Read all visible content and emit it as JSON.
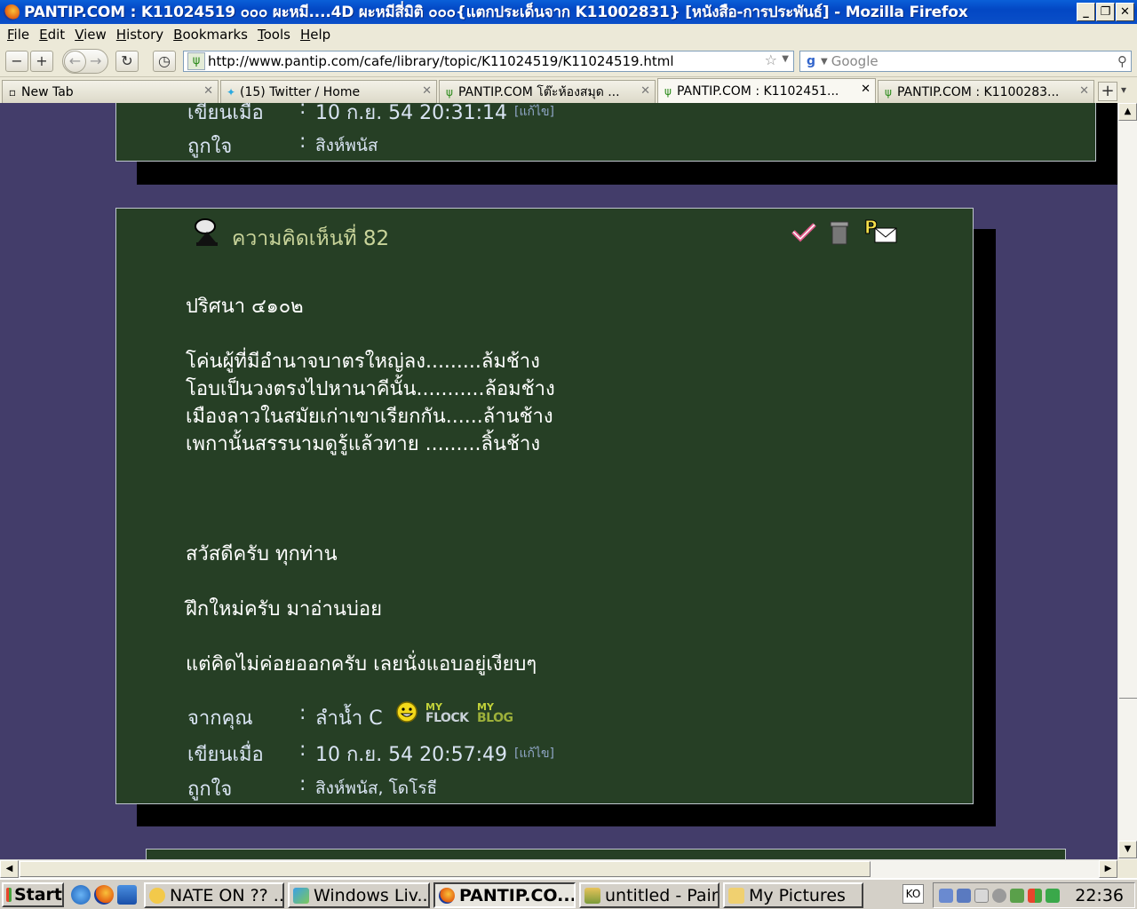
{
  "window": {
    "title": "PANTIP.COM : K11024519 ๐๐๐ ผะหมี....4D ผะหมีสี่มิติ ๐๐๐{แตกประเด็นจาก K11002831} [หนังสือ-การประพันธ์] - Mozilla Firefox"
  },
  "menu": [
    "File",
    "Edit",
    "View",
    "History",
    "Bookmarks",
    "Tools",
    "Help"
  ],
  "nav": {
    "url": "http://www.pantip.com/cafe/library/topic/K11024519/K11024519.html",
    "search_placeholder": "Google"
  },
  "tabs": [
    {
      "label": "New Tab",
      "icon": "page-icon"
    },
    {
      "label": "(15) Twitter / Home",
      "icon": "twitter-bird-icon"
    },
    {
      "label": "PANTIP.COM โต๊ะห้องสมุด ...",
      "icon": "cactus-icon"
    },
    {
      "label": "PANTIP.COM : K1102451...",
      "icon": "cactus-icon",
      "active": true
    },
    {
      "label": "PANTIP.COM : K1100283...",
      "icon": "cactus-icon"
    }
  ],
  "prev_comment": {
    "written_label": "เขียนเมื่อ",
    "written_value": "10 ก.ย. 54 20:31:14",
    "edit": "[แก้ไข]",
    "likes_label": "ถูกใจ",
    "likes_value": "สิงห์พนัส"
  },
  "comment": {
    "title": "ความคิดเห็นที่ 82",
    "lines": [
      "ปริศนา ๔๑๐๒",
      "โค่นผู้ที่มีอำนาจบาตรใหญ่ลง.........ล้มช้าง",
      "โอบเป็นวงตรงไปหานาคีนั้น...........ล้อมช้าง",
      "เมืองลาวในสมัยเก่าเขาเรียกกัน......ล้านช้าง",
      "เพกานั้นสรรนามดูรู้แล้วทาย  .........ลิ้นช้าง",
      "สวัสดีครับ ทุกท่าน",
      "ฝึกใหม่ครับ มาอ่านบ่อย",
      "แต่คิดไม่ค่อยออกครับ เลยนั่งแอบอยู่เงียบๆ"
    ],
    "from_label": "จากคุณ",
    "from_value": "ลำน้ำ C",
    "myflock": "FLOCK",
    "myblog": "BLOG",
    "my": "MY",
    "written_label": "เขียนเมื่อ",
    "written_value": "10 ก.ย. 54 20:57:49",
    "edit": "[แก้ไข]",
    "likes_label": "ถูกใจ",
    "likes_value": "สิงห์พนัส, โดโรธี"
  },
  "taskbar": {
    "start": "Start",
    "tasks": [
      {
        "label": "NATE ON ?? ...",
        "icon": "nateon-icon"
      },
      {
        "label": "Windows Liv...",
        "icon": "windows-live-icon"
      },
      {
        "label": "PANTIP.CO...",
        "icon": "firefox-icon",
        "active": true
      },
      {
        "label": "untitled - Paint",
        "icon": "paint-icon"
      },
      {
        "label": "My Pictures",
        "icon": "folder-icon"
      }
    ],
    "lang": "KO",
    "clock": "22:36"
  },
  "colors": {
    "page_bg": "#433D6A",
    "card_bg": "#263F25",
    "title_text": "#C9D49A",
    "meta_text": "#D9E4F3"
  }
}
